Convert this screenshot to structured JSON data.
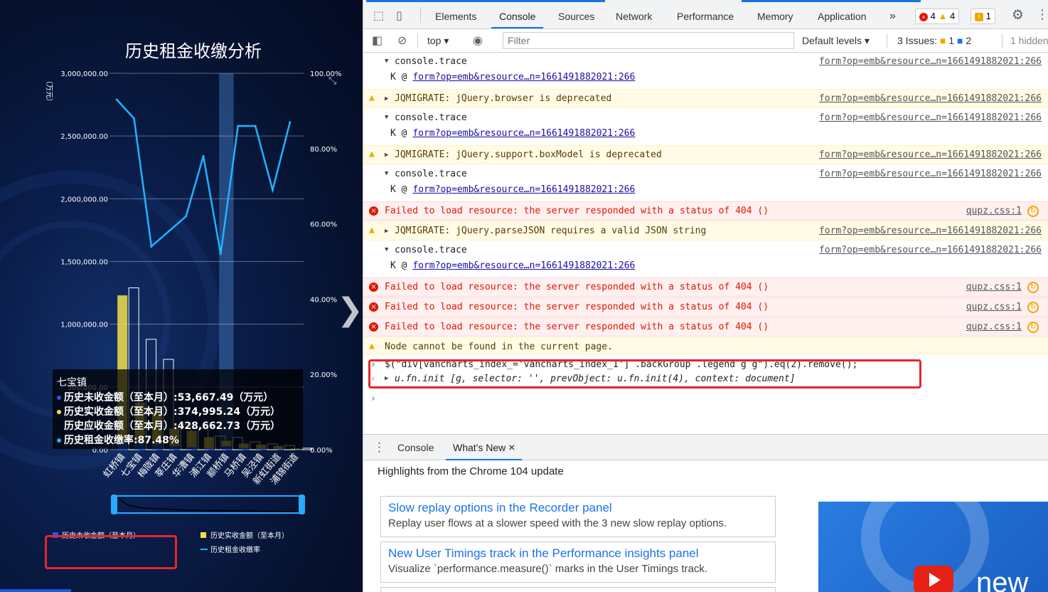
{
  "chart_data": {
    "type": "bar",
    "title": "历史租金收缴分析",
    "ylabel": "（万元）",
    "categories": [
      "虹桥镇",
      "七宝镇",
      "梅陇镇",
      "莘庄镇",
      "华漕镇",
      "浦江镇",
      "颛桥镇",
      "马桥镇",
      "吴泾镇",
      "新虹街道",
      "浦锦街道"
    ],
    "ylim": [
      0,
      3000000
    ],
    "y2lim": [
      0,
      1
    ],
    "y_ticks": [
      "0.00",
      "500,000.00",
      "1,000,000.00",
      "1,500,000.00",
      "2,000,000.00",
      "2,500,000.00",
      "3,000,000.00"
    ],
    "y2_ticks": [
      "0.00%",
      "20.00%",
      "40.00%",
      "60.00%",
      "80.00%",
      "100.00%"
    ],
    "series": [
      {
        "name": "历史未收金额（至本月）",
        "type": "bar",
        "color": "#1f5bd6",
        "values": [
          60000,
          53667,
          45000,
          30000,
          20000,
          8000,
          28000,
          12000,
          6000,
          4000,
          2000
        ]
      },
      {
        "name": "历史实收金额（至本月）",
        "type": "bar",
        "color": "#f5e04c",
        "values": [
          1230000,
          374995,
          310000,
          170000,
          150000,
          100000,
          70000,
          50000,
          40000,
          30000,
          10000
        ]
      },
      {
        "name": "历史应收金额",
        "type": "bar-outline",
        "color": "#ffffff",
        "values": [
          1290000,
          880000,
          720000,
          200000,
          170000,
          108000,
          98000,
          62000,
          46000,
          34000,
          12000
        ]
      },
      {
        "name": "历史租金收缴率",
        "type": "line",
        "color": "#1fb4ff",
        "values": [
          0.93,
          0.88,
          0.54,
          0.58,
          0.62,
          0.78,
          0.52,
          0.86,
          0.86,
          0.69,
          0.87
        ]
      }
    ],
    "highlight_index": 6,
    "legend": [
      "历史未收金额（至本月）",
      "历史实收金额（至本月）",
      "历史租金收缴率"
    ],
    "legend_position": "bottom"
  },
  "tooltip": {
    "title": "七宝镇",
    "rows": [
      {
        "text": "历史未收金额（至本月）:53,667.49（万元）",
        "color": "#1f5bd6"
      },
      {
        "text": "历史实收金额（至本月）:374,995.24（万元）",
        "color": "#f5e04c"
      },
      {
        "text": "历史应收金额（至本月）:428,662.73（万元）",
        "color": ""
      },
      {
        "text": "历史租金收缴率:87.48%",
        "color": "#1fb4ff"
      }
    ]
  },
  "devtools": {
    "tabs": [
      "Elements",
      "Console",
      "Sources",
      "Network",
      "Performance",
      "Memory",
      "Application"
    ],
    "more": "»",
    "badges": {
      "errors": "4",
      "warnings": "4",
      "info": "1"
    },
    "toolbar": {
      "context": "top",
      "filter_placeholder": "Filter",
      "levels": "Default levels",
      "issues_label": "3 Issues:",
      "issues_warn": "1",
      "issues_info": "2",
      "hidden": "1 hidden"
    },
    "log": [
      {
        "kind": "trace",
        "msg": "console.trace",
        "src": "form?op=emb&resource…n=1661491882021:266",
        "sub": "K @ ",
        "sublink": "form?op=emb&resource…n=1661491882021:266"
      },
      {
        "kind": "warn",
        "msg": "JQMIGRATE: jQuery.browser is deprecated",
        "src": "form?op=emb&resource…n=1661491882021:266"
      },
      {
        "kind": "trace",
        "msg": "console.trace",
        "src": "form?op=emb&resource…n=1661491882021:266",
        "sub": "K @ ",
        "sublink": "form?op=emb&resource…n=1661491882021:266"
      },
      {
        "kind": "warn",
        "msg": "JQMIGRATE: jQuery.support.boxModel is deprecated",
        "src": "form?op=emb&resource…n=1661491882021:266"
      },
      {
        "kind": "trace",
        "msg": "console.trace",
        "src": "form?op=emb&resource…n=1661491882021:266",
        "sub": "K @ ",
        "sublink": "form?op=emb&resource…n=1661491882021:266"
      },
      {
        "kind": "err",
        "msg": "Failed to load resource: the server responded with a status of 404 ()",
        "src": "qupz.css:1"
      },
      {
        "kind": "warn",
        "msg": "JQMIGRATE: jQuery.parseJSON requires a valid JSON string",
        "src": "form?op=emb&resource…n=1661491882021:266"
      },
      {
        "kind": "trace",
        "msg": "console.trace",
        "src": "form?op=emb&resource…n=1661491882021:266",
        "sub": "K @ ",
        "sublink": "form?op=emb&resource…n=1661491882021:266"
      },
      {
        "kind": "err",
        "msg": "Failed to load resource: the server responded with a status of 404 ()",
        "src": "qupz.css:1"
      },
      {
        "kind": "err",
        "msg": "Failed to load resource: the server responded with a status of 404 ()",
        "src": "qupz.css:1"
      },
      {
        "kind": "err",
        "msg": "Failed to load resource: the server responded with a status of 404 ()",
        "src": "qupz.css:1"
      },
      {
        "kind": "warn",
        "msg": "Node cannot be found in the current page.",
        "src": ""
      }
    ],
    "command": "$(\"div[vancharts_index_='vancharts_index_1'] .backGroup .legend g g\").eq(2).remove();",
    "result": "u.fn.init [g, selector: '', prevObject: u.fn.init(4), context: document]",
    "prompt": "›"
  },
  "drawer": {
    "tabs": [
      "Console",
      "What's New"
    ],
    "close": "×",
    "heading": "Highlights from the Chrome 104 update",
    "cards": [
      {
        "title": "Slow replay options in the Recorder panel",
        "desc": "Replay user flows at a slower speed with the 3 new slow replay options."
      },
      {
        "title": "New User Timings track in the Performance insights panel",
        "desc": "Visualize `performance.measure()` marks in the User Timings track."
      }
    ],
    "video_label": "new"
  }
}
